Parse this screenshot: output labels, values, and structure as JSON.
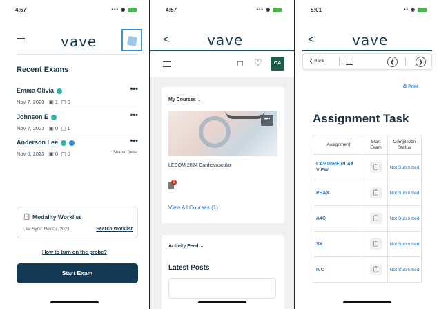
{
  "panel1": {
    "status_time": "4:57",
    "status_icons": "••• ◉",
    "logo": "vave",
    "section_title": "Recent Exams",
    "exams": [
      {
        "name": "Emma Olivia",
        "date": "Nov 7, 2023",
        "images": "1",
        "clips": "0",
        "more": "•••",
        "shared": ""
      },
      {
        "name": "Johnson E",
        "date": "Nov 7, 2023",
        "images": "0",
        "clips": "1",
        "more": "•••",
        "shared": ""
      },
      {
        "name": "Anderson Lee",
        "date": "Nov 6, 2023",
        "images": "0",
        "clips": "0",
        "more": "•••",
        "shared": "Shared folder"
      }
    ],
    "worklist": {
      "title": "Modality Worklist",
      "last_sync": "Last Sync: Nov 07, 2023",
      "search": "Search Worklist"
    },
    "probe_link": "How to turn on the probe?",
    "start_exam": "Start Exam"
  },
  "panel2": {
    "status_time": "4:57",
    "status_icons": "••• ◉",
    "logo": "vave",
    "back": "<",
    "avatar_initials": "OA",
    "my_courses": "My Courses",
    "course_menu": "•••",
    "course_title": "LECOM 2024 Cardiovascular",
    "course_badge": "1",
    "view_all": "View All Courses (1)",
    "activity_feed": "Activity Feed",
    "latest_posts": "Latest Posts"
  },
  "panel3": {
    "status_time": "5:01",
    "status_icons": "•• ◉",
    "logo": "vave",
    "back": "<",
    "bar_back": "Back",
    "print": "Print",
    "page_title": "Assignment Task",
    "table_headers": [
      "Assignment",
      "Start Exam",
      "Completion Status"
    ],
    "rows": [
      {
        "assignment": "CAPTURE PLAX VIEW",
        "status": "Not Submitted"
      },
      {
        "assignment": "PSAX",
        "status": "Not Submitted"
      },
      {
        "assignment": "A4C",
        "status": "Not Submitted"
      },
      {
        "assignment": "SX",
        "status": "Not Submitted"
      },
      {
        "assignment": "IVC",
        "status": "Not Submitted"
      }
    ]
  },
  "icons": {
    "menu": "hamburger-icon",
    "chat": "chat-icon",
    "bell": "bell-icon",
    "clipboard": "clipboard-icon",
    "printer": "printer-icon"
  },
  "colors": {
    "brand": "#17394f",
    "accent": "#2b76c2",
    "button": "#123a52",
    "avatar": "#1d5d4c"
  }
}
